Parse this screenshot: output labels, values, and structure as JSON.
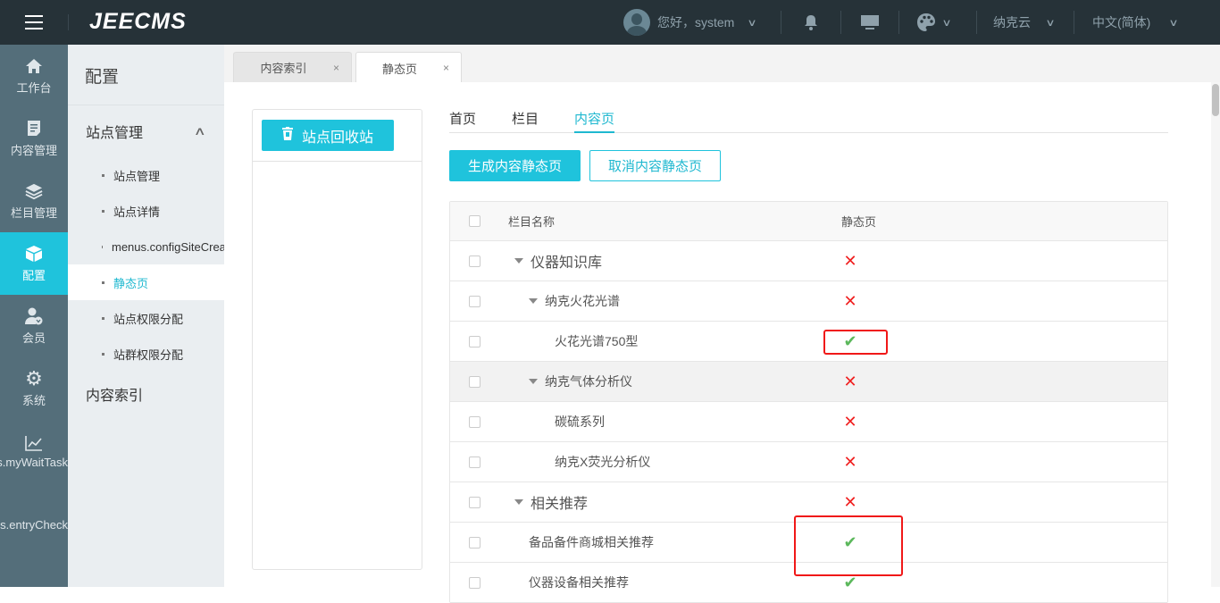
{
  "topbar": {
    "logo": "JEECMS",
    "greeting": "您好，system",
    "site": "纳克云",
    "language": "中文(简体)"
  },
  "iconbar": [
    {
      "label": "工作台",
      "icon": "home-icon"
    },
    {
      "label": "内容管理",
      "icon": "document-icon"
    },
    {
      "label": "栏目管理",
      "icon": "layers-icon"
    },
    {
      "label": "配置",
      "icon": "cube-icon",
      "active": true
    },
    {
      "label": "会员",
      "icon": "member-icon"
    },
    {
      "label": "系统",
      "icon": "gear-icon"
    },
    {
      "label": "menus.myWaitTask",
      "icon": "chart-icon"
    },
    {
      "label": "menus.entryCheck",
      "icon": ""
    }
  ],
  "sidebar": {
    "title": "配置",
    "group": "站点管理",
    "items": [
      "站点管理",
      "站点详情",
      "menus.configSiteCreate",
      "静态页",
      "站点权限分配",
      "站群权限分配"
    ],
    "group2": "内容索引"
  },
  "tabs": [
    {
      "label": "内容索引"
    },
    {
      "label": "静态页"
    }
  ],
  "panel": {
    "recycle_button": "站点回收站"
  },
  "subtabs": [
    "首页",
    "栏目",
    "内容页"
  ],
  "actions": {
    "generate": "生成内容静态页",
    "cancel": "取消内容静态页"
  },
  "table": {
    "headers": [
      "栏目名称",
      "静态页"
    ],
    "rows": [
      {
        "name": "仪器知识库",
        "level": 0,
        "expand": true,
        "static": false
      },
      {
        "name": "纳克火花光谱",
        "level": 1,
        "expand": true,
        "static": false
      },
      {
        "name": "火花光谱750型",
        "level": 2,
        "expand": false,
        "static": true
      },
      {
        "name": "纳克气体分析仪",
        "level": 1,
        "expand": true,
        "static": false
      },
      {
        "name": "碳硫系列",
        "level": 2,
        "expand": false,
        "static": false
      },
      {
        "name": "纳克X荧光分析仪",
        "level": 2,
        "expand": false,
        "static": false
      },
      {
        "name": "相关推荐",
        "level": 0,
        "expand": true,
        "static": false
      },
      {
        "name": "备品备件商城相关推荐",
        "level": 1,
        "expand": false,
        "static": true
      },
      {
        "name": "仪器设备相关推荐",
        "level": 1,
        "expand": false,
        "static": true
      }
    ]
  },
  "colors": {
    "accent": "#1fc3dc",
    "topbar": "#263238",
    "iconbar": "#546e7a",
    "no": "#f02020",
    "yes": "#5cb85c"
  }
}
